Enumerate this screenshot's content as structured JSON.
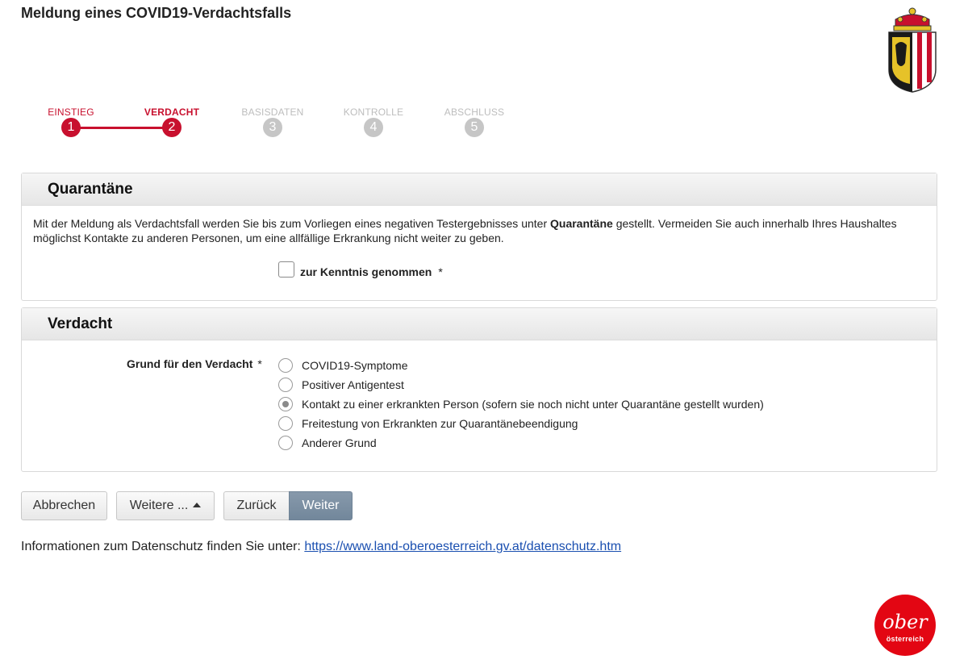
{
  "page": {
    "title": "Meldung eines COVID19-Verdachtsfalls"
  },
  "stepper": {
    "steps": [
      {
        "label": "EINSTIEG",
        "number": "1",
        "state": "done"
      },
      {
        "label": "VERDACHT",
        "number": "2",
        "state": "active"
      },
      {
        "label": "BASISDATEN",
        "number": "3",
        "state": "todo"
      },
      {
        "label": "KONTROLLE",
        "number": "4",
        "state": "todo"
      },
      {
        "label": "ABSCHLUSS",
        "number": "5",
        "state": "todo"
      }
    ]
  },
  "quarantaene": {
    "heading": "Quarantäne",
    "text_before": "Mit der Meldung als Verdachtsfall werden Sie bis zum Vorliegen eines negativen Testergebnisses unter ",
    "text_bold": "Quarantäne",
    "text_after": " gestellt. Vermeiden Sie auch innerhalb Ihres Haushaltes möglichst Kontakte zu anderen Personen, um eine allfällige Erkrankung nicht weiter zu geben.",
    "ack_label": "zur Kenntnis genommen",
    "ack_checked": false,
    "required_marker": "*"
  },
  "verdacht": {
    "heading": "Verdacht",
    "field_label": "Grund für den Verdacht",
    "required_marker": "*",
    "options": [
      {
        "label": "COVID19-Symptome",
        "checked": false
      },
      {
        "label": "Positiver Antigentest",
        "checked": false
      },
      {
        "label": "Kontakt zu einer erkrankten Person (sofern sie noch nicht unter Quarantäne gestellt wurden)",
        "checked": true
      },
      {
        "label": "Freitestung von Erkrankten zur Quarantänebeendigung",
        "checked": false
      },
      {
        "label": "Anderer Grund",
        "checked": false
      }
    ]
  },
  "buttons": {
    "cancel": "Abbrechen",
    "more": "Weitere ...",
    "back": "Zurück",
    "next": "Weiter"
  },
  "privacy": {
    "text": "Informationen zum Datenschutz finden Sie unter: ",
    "link": "https://www.land-oberoesterreich.gv.at/datenschutz.htm"
  },
  "logo": {
    "script": "ober",
    "sub": "österreich"
  },
  "colors": {
    "accent": "#c8102e",
    "inactive_step": "#c6c6c6",
    "primary_button": "#7a8ea2",
    "link": "#1a4fb0"
  }
}
